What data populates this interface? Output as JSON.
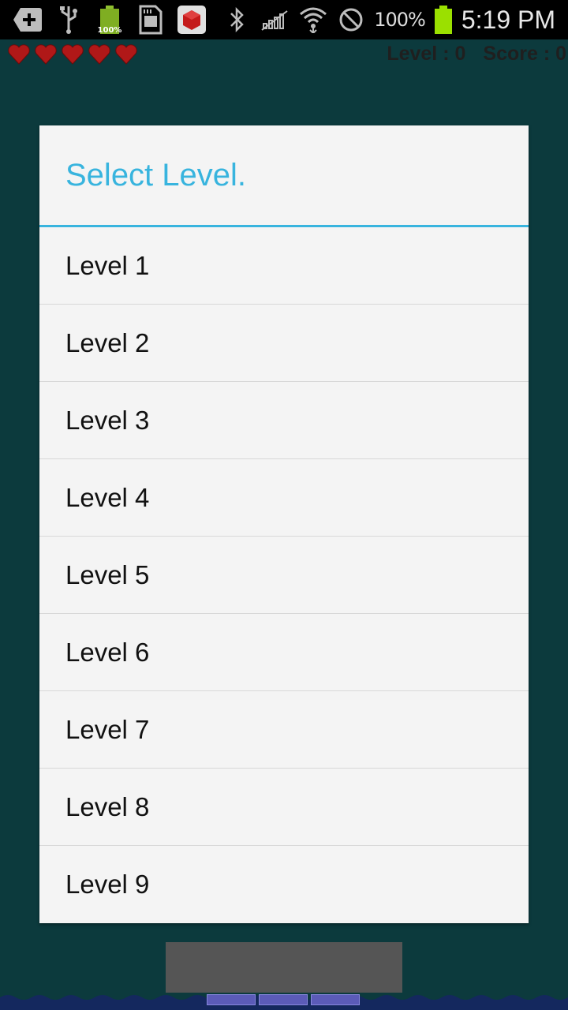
{
  "status_bar": {
    "icons": [
      "add-notification-icon",
      "usb-icon",
      "battery-widget-icon",
      "sd-card-icon",
      "app-cube-icon",
      "bluetooth-icon",
      "no-sim-icon",
      "wifi-icon",
      "do-not-disturb-icon",
      "battery-icon"
    ],
    "battery_widget_label": "100%",
    "battery_percent": "100%",
    "time": "5:19 PM"
  },
  "hud": {
    "lives": 5,
    "level_text": "Level : 0",
    "score_text": "Score : 0"
  },
  "dialog": {
    "title": "Select Level.",
    "items": [
      {
        "label": "Level 1"
      },
      {
        "label": "Level 2"
      },
      {
        "label": "Level 3"
      },
      {
        "label": "Level 4"
      },
      {
        "label": "Level 5"
      },
      {
        "label": "Level 6"
      },
      {
        "label": "Level 7"
      },
      {
        "label": "Level 8"
      },
      {
        "label": "Level 9"
      }
    ]
  },
  "colors": {
    "accent": "#38b4de",
    "background": "#0c3a3d",
    "heart": "#b01818",
    "battery": "#9be000"
  }
}
